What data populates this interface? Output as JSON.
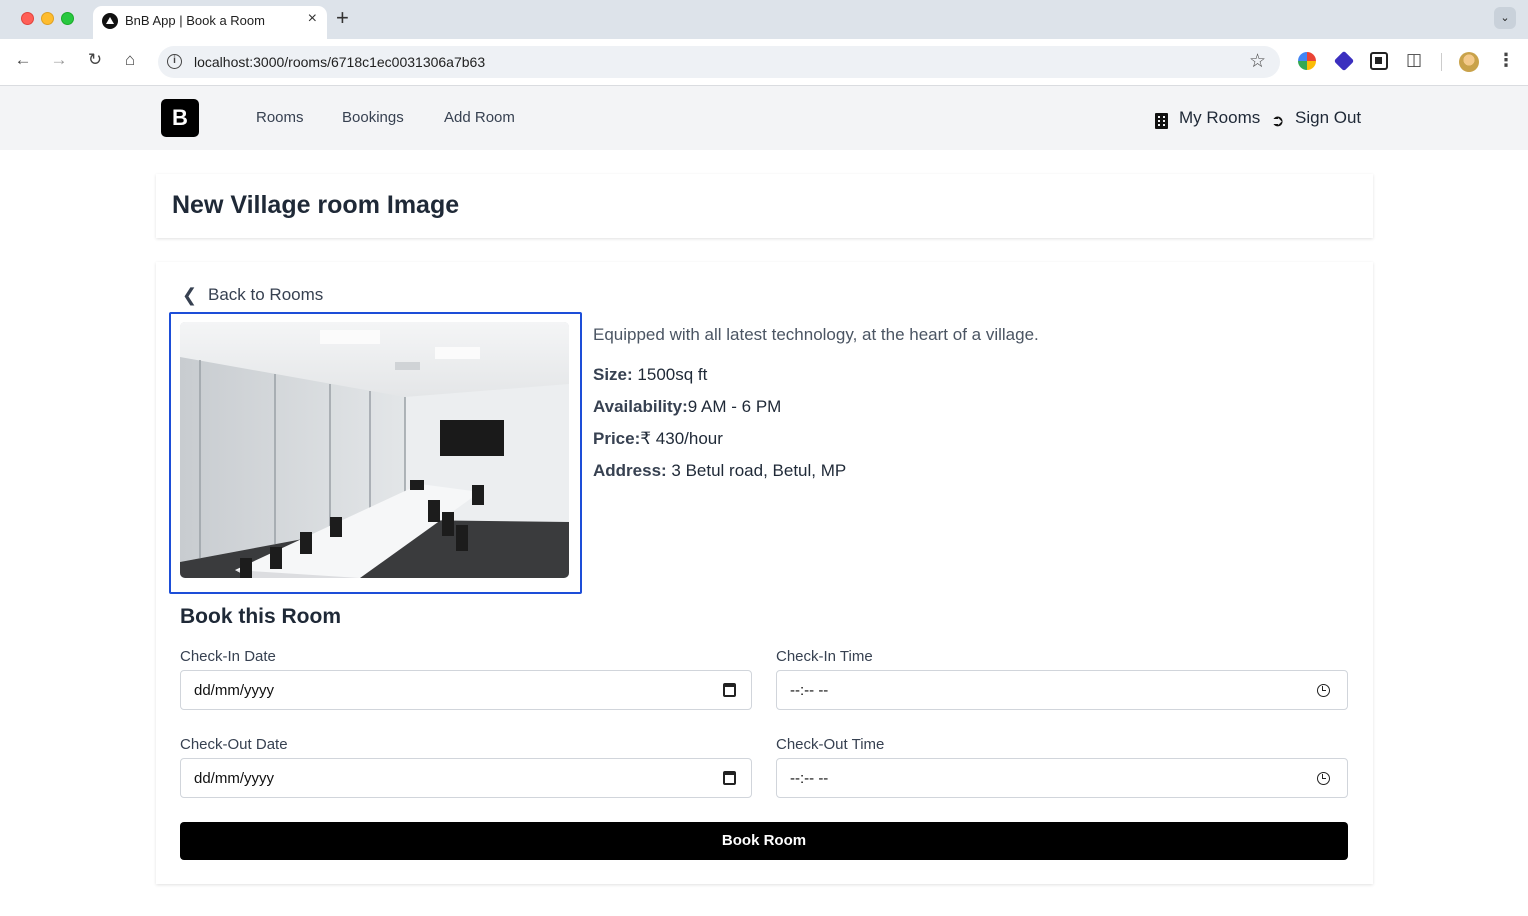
{
  "browser": {
    "tab_title": "BnB App | Book a Room",
    "tab_close": "×",
    "new_tab": "+",
    "tab_menu": "⌄",
    "url": "localhost:3000/rooms/6718c1ec0031306a7b63"
  },
  "nav": {
    "logo": "B",
    "links": [
      "Rooms",
      "Bookings",
      "Add Room"
    ],
    "my_rooms": "My Rooms",
    "sign_out": "Sign Out"
  },
  "page": {
    "title": "New Village room Image",
    "back": "Back to Rooms"
  },
  "room": {
    "description": "Equipped with all latest technology, at the heart of a village.",
    "size_label": "Size:",
    "size_value": " 1500sq ft",
    "availability_label": "Availability:",
    "availability_value": "9 AM - 6 PM",
    "price_label": "Price:",
    "price_value": "₹ 430/hour",
    "address_label": "Address:",
    "address_value": " 3 Betul road, Betul, MP"
  },
  "booking": {
    "title": "Book this Room",
    "check_in_date_label": "Check-In Date",
    "check_in_date_value": "dd/mm/yyyy",
    "check_in_time_label": "Check-In Time",
    "check_in_time_value": "--:-- --",
    "check_out_date_label": "Check-Out Date",
    "check_out_date_value": "dd/mm/yyyy",
    "check_out_time_label": "Check-Out Time",
    "check_out_time_value": "--:-- --",
    "submit": "Book Room"
  },
  "colors": {
    "accent": "#000000",
    "image_highlight": "#1d4ed8",
    "nav_bg": "#f3f4f6"
  }
}
